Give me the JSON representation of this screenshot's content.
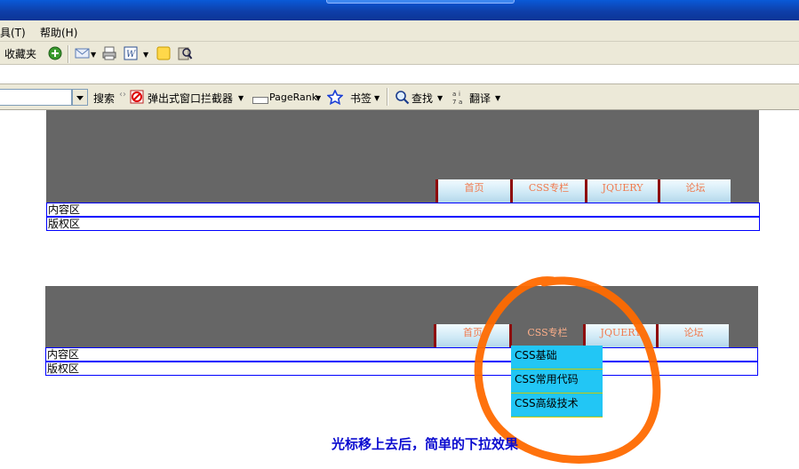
{
  "menu": {
    "tools": "具(T)",
    "help": "帮助(H)"
  },
  "toolbar1": {
    "favorites": "收藏夹"
  },
  "toolbar2": {
    "search": "搜索",
    "popup_blocker": "弹出式窗口拦截器",
    "pagerank": "PageRank",
    "bookmarks": "书签",
    "find": "查找",
    "translate": "翻译"
  },
  "demo1": {
    "nav": [
      "首页",
      "CSS专栏",
      "JQUERY",
      "论坛"
    ],
    "content": "内容区",
    "copyright": "版权区"
  },
  "demo2": {
    "nav": [
      "首页",
      "CSS专栏",
      "JQUERY",
      "论坛"
    ],
    "content": "内容区",
    "copyright": "版权区",
    "dropdown": [
      "CSS基础",
      "CSS常用代码",
      "CSS高级技术"
    ]
  },
  "caption": "光标移上去后，简单的下拉效果",
  "colors": {
    "header_bg": "#666666",
    "nav_border": "#8e0b0b",
    "nav_text": "#f07a4d",
    "dropdown_bg": "#22c6f5",
    "caption": "#0b0bcf",
    "annotation": "#ff6a00"
  }
}
